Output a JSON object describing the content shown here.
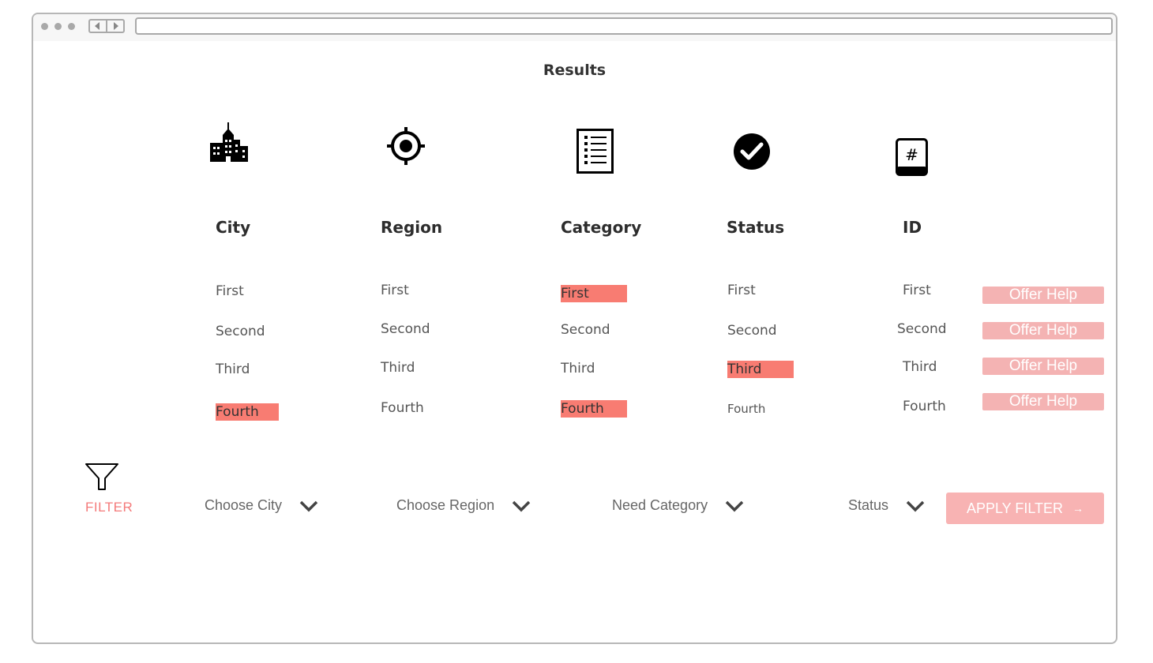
{
  "page": {
    "title": "Results"
  },
  "columns": [
    {
      "label": "City",
      "icon": "building-icon"
    },
    {
      "label": "Region",
      "icon": "location-target-icon"
    },
    {
      "label": "Category",
      "icon": "list-document-icon"
    },
    {
      "label": "Status",
      "icon": "check-circle-icon"
    },
    {
      "label": "ID",
      "icon": "hash-key-icon"
    }
  ],
  "rows": {
    "city": [
      "First",
      "Second",
      "Third",
      "Fourth"
    ],
    "region": [
      "First",
      "Second",
      "Third",
      "Fourth"
    ],
    "category": [
      "First",
      "Second",
      "Third",
      "Fourth"
    ],
    "status": [
      "First",
      "Second",
      "Third",
      "Fourth"
    ],
    "id": [
      "First",
      "Second",
      "Third",
      "Fourth"
    ]
  },
  "actions": {
    "offer_help_label": "Offer Help"
  },
  "filter": {
    "label": "FILTER",
    "city_placeholder": "Choose City",
    "region_placeholder": "Choose Region",
    "category_placeholder": "Need Category",
    "status_placeholder": "Status",
    "apply_label": "APPLY FILTER",
    "apply_arrow": "→"
  },
  "colors": {
    "highlight": "#f87c72",
    "accent": "#f47a7a",
    "button": "#f4b3b3"
  }
}
